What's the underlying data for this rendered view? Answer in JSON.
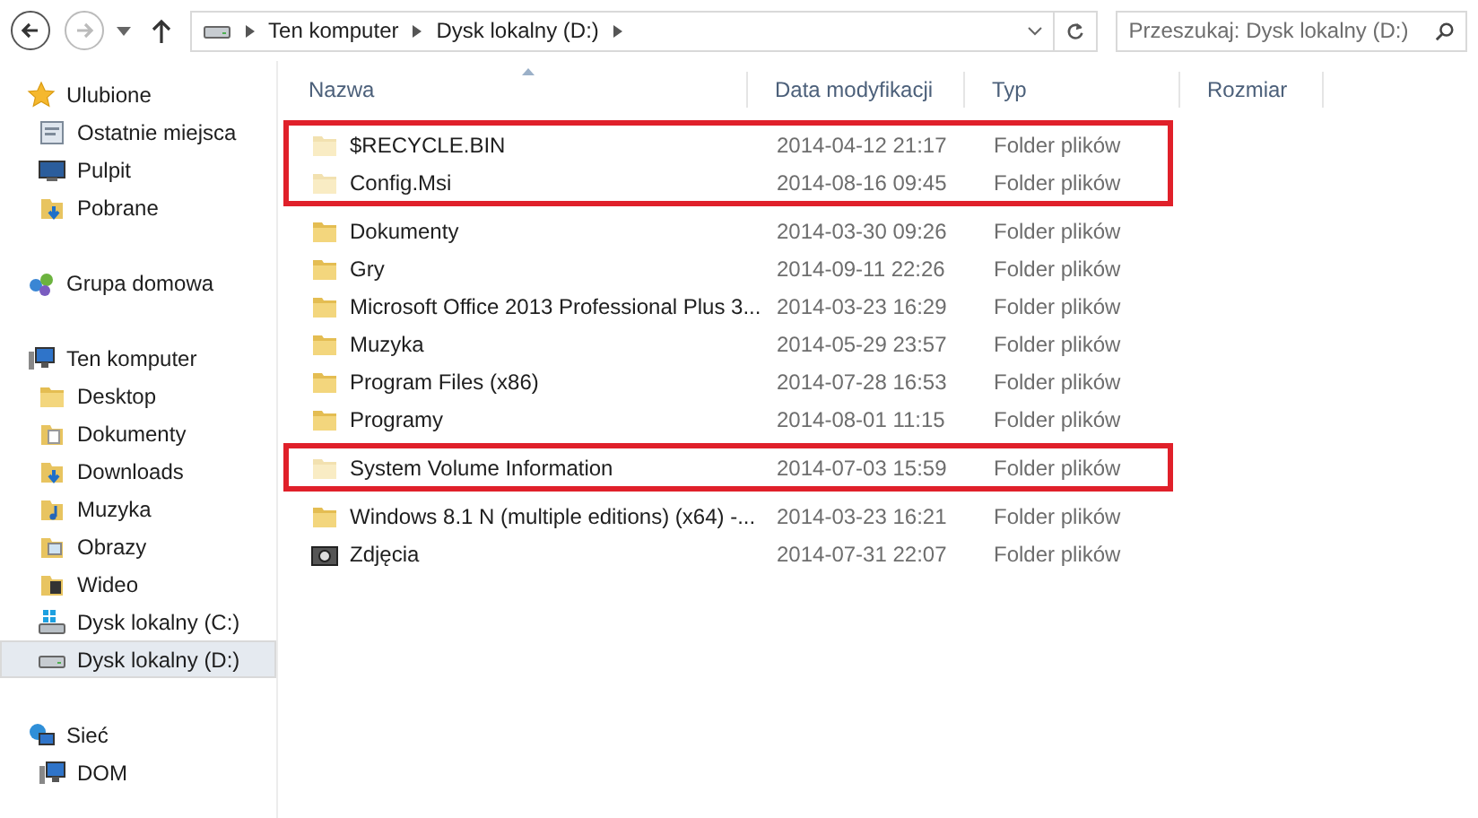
{
  "address_bar": {
    "segments": [
      "Ten komputer",
      "Dysk lokalny (D:)"
    ]
  },
  "search": {
    "placeholder": "Przeszukaj: Dysk lokalny (D:)"
  },
  "sidebar": {
    "items": [
      {
        "label": "Ulubione",
        "kind": "star",
        "selected": false,
        "children": [
          {
            "label": "Ostatnie miejsca",
            "kind": "recent",
            "selected": false
          },
          {
            "label": "Pulpit",
            "kind": "monitor",
            "selected": false
          },
          {
            "label": "Pobrane",
            "kind": "download",
            "selected": false
          }
        ]
      },
      {
        "label": "Grupa domowa",
        "kind": "homegroup",
        "selected": false
      },
      {
        "label": "Ten komputer",
        "kind": "computer",
        "selected": false,
        "children": [
          {
            "label": "Desktop",
            "kind": "folder",
            "selected": false
          },
          {
            "label": "Dokumenty",
            "kind": "docs",
            "selected": false
          },
          {
            "label": "Downloads",
            "kind": "download",
            "selected": false
          },
          {
            "label": "Muzyka",
            "kind": "music",
            "selected": false
          },
          {
            "label": "Obrazy",
            "kind": "pictures",
            "selected": false
          },
          {
            "label": "Wideo",
            "kind": "video",
            "selected": false
          },
          {
            "label": "Dysk lokalny (C:)",
            "kind": "windrive",
            "selected": false
          },
          {
            "label": "Dysk lokalny (D:)",
            "kind": "drive",
            "selected": true
          }
        ]
      },
      {
        "label": "Sieć",
        "kind": "network",
        "selected": false,
        "children": [
          {
            "label": "DOM",
            "kind": "computer",
            "selected": false
          }
        ]
      }
    ]
  },
  "table": {
    "columns": [
      "Nazwa",
      "Data modyfikacji",
      "Typ",
      "Rozmiar"
    ],
    "rows": [
      {
        "name": "$RECYCLE.BIN",
        "date": "2014-04-12 21:17",
        "type": "Folder plików",
        "hidden": true,
        "marked": true,
        "kind": "folder"
      },
      {
        "name": "Config.Msi",
        "date": "2014-08-16 09:45",
        "type": "Folder plików",
        "hidden": true,
        "marked": true,
        "kind": "folder"
      },
      {
        "name": "Dokumenty",
        "date": "2014-03-30 09:26",
        "type": "Folder plików",
        "hidden": false,
        "marked": false,
        "kind": "folder"
      },
      {
        "name": "Gry",
        "date": "2014-09-11 22:26",
        "type": "Folder plików",
        "hidden": false,
        "marked": false,
        "kind": "folder"
      },
      {
        "name": "Microsoft Office 2013 Professional Plus 3...",
        "date": "2014-03-23 16:29",
        "type": "Folder plików",
        "hidden": false,
        "marked": false,
        "kind": "folder"
      },
      {
        "name": "Muzyka",
        "date": "2014-05-29 23:57",
        "type": "Folder plików",
        "hidden": false,
        "marked": false,
        "kind": "folder"
      },
      {
        "name": "Program Files (x86)",
        "date": "2014-07-28 16:53",
        "type": "Folder plików",
        "hidden": false,
        "marked": false,
        "kind": "folder"
      },
      {
        "name": "Programy",
        "date": "2014-08-01 11:15",
        "type": "Folder plików",
        "hidden": false,
        "marked": false,
        "kind": "folder"
      },
      {
        "name": "System Volume Information",
        "date": "2014-07-03 15:59",
        "type": "Folder plików",
        "hidden": true,
        "marked": true,
        "kind": "folder"
      },
      {
        "name": "Windows 8.1 N (multiple editions) (x64) -...",
        "date": "2014-03-23 16:21",
        "type": "Folder plików",
        "hidden": false,
        "marked": false,
        "kind": "folder"
      },
      {
        "name": "Zdjęcia",
        "date": "2014-07-31 22:07",
        "type": "Folder plików",
        "hidden": false,
        "marked": false,
        "kind": "camera"
      }
    ]
  }
}
